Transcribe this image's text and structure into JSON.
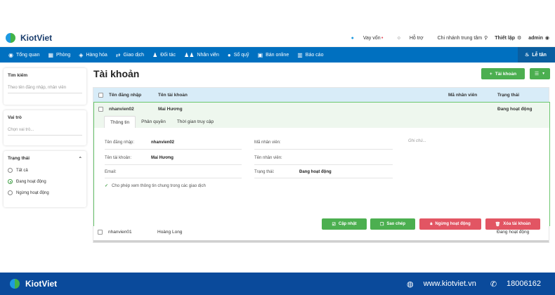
{
  "brand": {
    "name": "KiotViet"
  },
  "topbar": {
    "loan": "Vay vốn",
    "support": "Hỗ trợ",
    "branch": "Chi nhánh trung tâm",
    "settings": "Thiết lập",
    "user": "admin"
  },
  "nav": [
    {
      "icon": "eye-icon",
      "label": "Tổng quan"
    },
    {
      "icon": "grid-icon",
      "label": "Phòng"
    },
    {
      "icon": "box-icon",
      "label": "Hàng hóa"
    },
    {
      "icon": "swap-icon",
      "label": "Giao dịch"
    },
    {
      "icon": "person-icon",
      "label": "Đối tác"
    },
    {
      "icon": "users-icon",
      "label": "Nhân viên"
    },
    {
      "icon": "coin-icon",
      "label": "Sổ quỹ"
    },
    {
      "icon": "cart-icon",
      "label": "Bán online"
    },
    {
      "icon": "chart-icon",
      "label": "Báo cáo"
    }
  ],
  "nav_right": "Lễ tân",
  "sidebar": {
    "search_title": "Tìm kiếm",
    "search_placeholder": "Theo tên đăng nhập, nhân viên",
    "role_title": "Vai trò",
    "role_placeholder": "Chọn vai trò...",
    "status_title": "Trạng thái",
    "status_options": [
      "Tất cả",
      "Đang hoạt động",
      "Ngừng hoạt động"
    ],
    "status_selected": 1
  },
  "page": {
    "title": "Tài khoản",
    "add_label": "Tài khoản"
  },
  "table": {
    "columns": [
      "Tên đăng nhập",
      "Tên tài khoản",
      "Mã nhân viên",
      "Trạng thái"
    ],
    "rows": [
      {
        "username": "nhanvien02",
        "name": "Mai Hương",
        "code": "",
        "status": "Đang hoạt động"
      },
      {
        "username": "nhanvien01",
        "name": "Hoàng Long",
        "code": "",
        "status": "Đang hoạt động"
      }
    ]
  },
  "detail": {
    "tabs": [
      "Thông tin",
      "Phân quyền",
      "Thời gian truy cập"
    ],
    "labels": {
      "username": "Tên đăng nhập:",
      "account": "Tên tài khoản:",
      "email": "Email:",
      "staff_code": "Mã nhân viên:",
      "staff_name": "Tên nhân viên:",
      "status": "Trạng thái:"
    },
    "values": {
      "username": "nhanvien02",
      "account": "Mai Hương",
      "status": "Đang hoạt động"
    },
    "note_placeholder": "Ghi chú...",
    "permission_text": "Cho phép xem thông tin chung trong các giao dịch",
    "buttons": {
      "update": "Cập nhật",
      "copy": "Sao chép",
      "deactivate": "Ngừng hoạt động",
      "delete": "Xóa tài khoản"
    }
  },
  "footer": {
    "brand": "KiotViet",
    "website": "www.kiotviet.vn",
    "phone": "18006162"
  },
  "colors": {
    "nav": "#0070c0",
    "green": "#4caf50",
    "red": "#e25563",
    "footer": "#0a4a9b"
  }
}
